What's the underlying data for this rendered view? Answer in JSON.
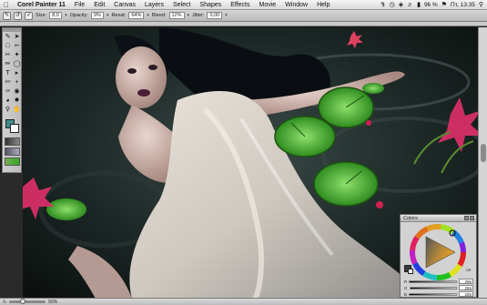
{
  "menubar": {
    "apple_icon": "apple-logo",
    "items": [
      {
        "label": "Corel Painter 11"
      },
      {
        "label": "File"
      },
      {
        "label": "Edit"
      },
      {
        "label": "Canvas"
      },
      {
        "label": "Layers"
      },
      {
        "label": "Select"
      },
      {
        "label": "Shapes"
      },
      {
        "label": "Effects"
      },
      {
        "label": "Movie"
      },
      {
        "label": "Window"
      },
      {
        "label": "Help"
      }
    ],
    "status": {
      "battery": "96 %",
      "clock": "Пт, 13:35"
    }
  },
  "propertybar": {
    "size_label": "Size:",
    "size_value": "8,0",
    "opacity_label": "Opacity:",
    "opacity_value": "9%",
    "resat_label": "Resat:",
    "resat_value": "64%",
    "bleed_label": "Bleed:",
    "bleed_value": "12%",
    "jitter_label": "Jitter:",
    "jitter_value": "0,00"
  },
  "bottombar": {
    "zoom_value": "50%",
    "zoom_fraction": 0.35
  },
  "colors_panel": {
    "title": "Colors",
    "sliders": [
      {
        "label": "R",
        "value": "255",
        "level": 1.0
      },
      {
        "label": "G",
        "value": "255",
        "level": 1.0
      },
      {
        "label": "B",
        "value": "255",
        "level": 1.0
      }
    ],
    "accent_color": "#e8a020"
  },
  "colors": {
    "primary_swatch": "#3f8c8c",
    "secondary_swatch": "#ffffff"
  }
}
